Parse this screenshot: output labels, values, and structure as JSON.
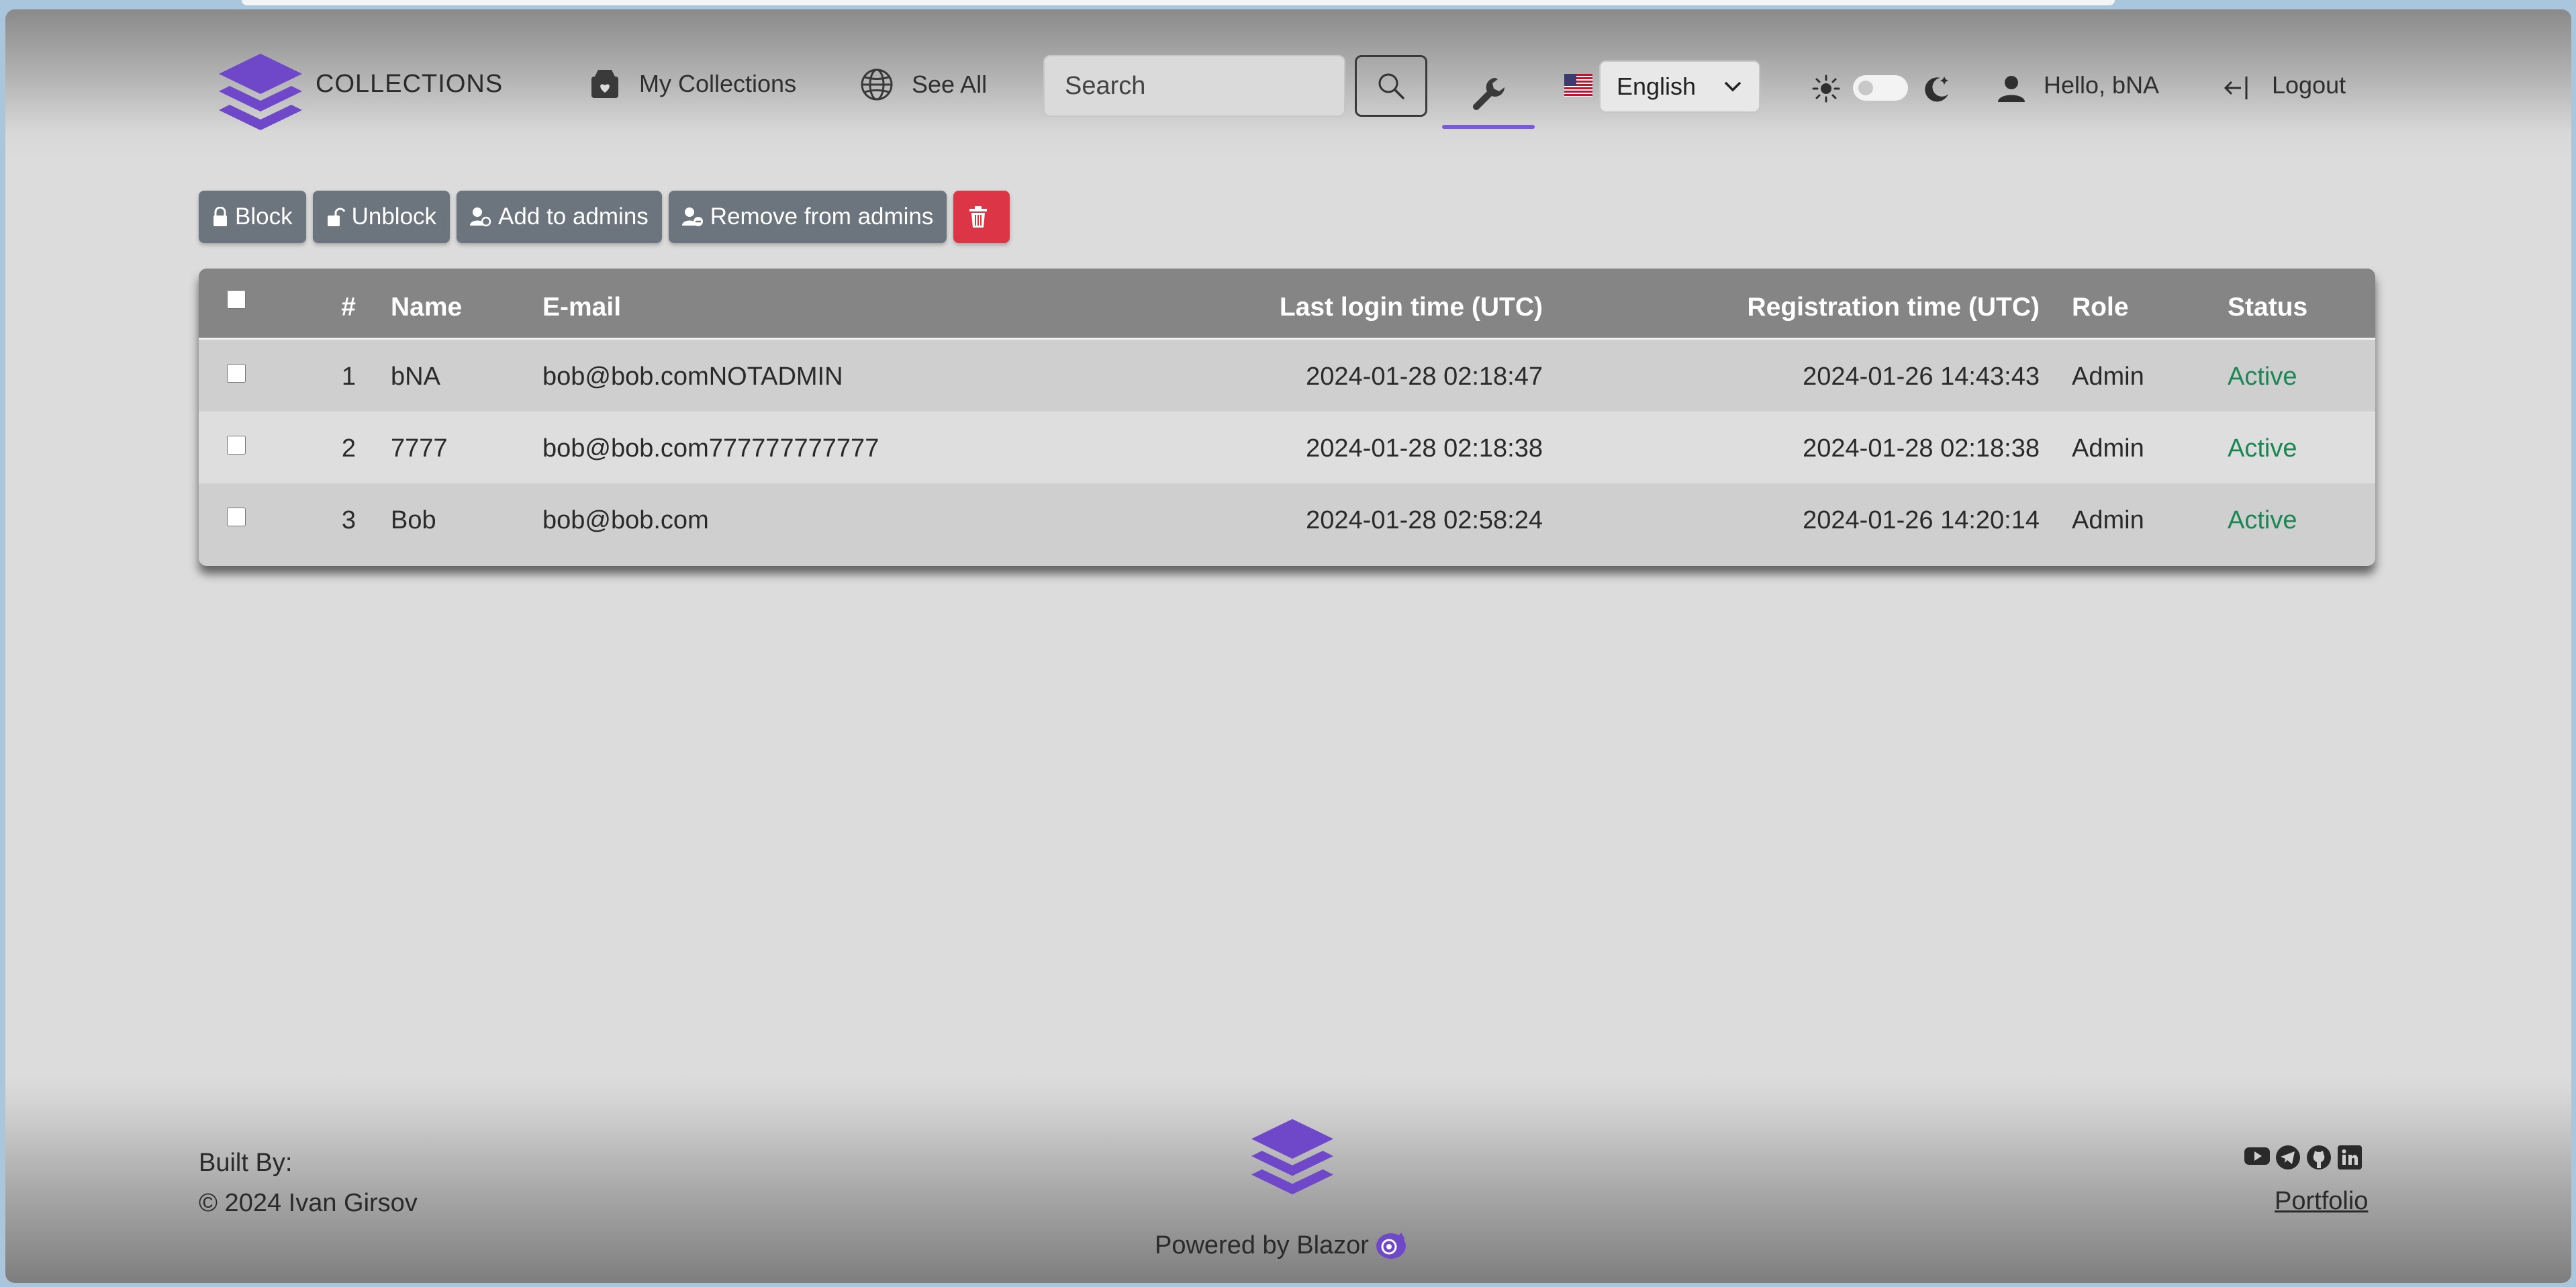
{
  "header": {
    "brand": "COLLECTIONS",
    "nav": [
      {
        "label": "My Collections",
        "icon": "box-heart-icon"
      },
      {
        "label": "See All",
        "icon": "globe-icon"
      }
    ],
    "search": {
      "placeholder": "Search",
      "value": ""
    },
    "language": {
      "selected": "English",
      "flag": "us-flag-icon"
    },
    "theme_toggle": {
      "dark": false
    },
    "user_greeting": "Hello, bNA",
    "logout_label": "Logout",
    "accent_color": "#7b5ad6"
  },
  "toolbar": {
    "block_label": "Block",
    "unblock_label": "Unblock",
    "add_admins_label": "Add to admins",
    "remove_admins_label": "Remove from admins",
    "delete_icon": "trash-icon",
    "delete_color": "#dc3545"
  },
  "table": {
    "columns": [
      "#",
      "Name",
      "E-mail",
      "Last login time (UTC)",
      "Registration time (UTC)",
      "Role",
      "Status"
    ],
    "rows": [
      {
        "num": "1",
        "name": "bNA",
        "email": "bob@bob.comNOTADMIN",
        "last_login": "2024-01-28 02:18:47",
        "registered": "2024-01-26 14:43:43",
        "role": "Admin",
        "status": "Active",
        "checked": false
      },
      {
        "num": "2",
        "name": "7777",
        "email": "bob@bob.com777777777777",
        "last_login": "2024-01-28 02:18:38",
        "registered": "2024-01-28 02:18:38",
        "role": "Admin",
        "status": "Active",
        "checked": false
      },
      {
        "num": "3",
        "name": "Bob",
        "email": "bob@bob.com",
        "last_login": "2024-01-28 02:58:24",
        "registered": "2024-01-26 14:20:14",
        "role": "Admin",
        "status": "Active",
        "checked": false
      }
    ],
    "status_color": "#198754"
  },
  "footer": {
    "built_by": "Built By:",
    "copyright": "© 2024 Ivan Girsov",
    "powered_by": "Powered by Blazor",
    "social": [
      "youtube-icon",
      "telegram-icon",
      "github-icon",
      "linkedin-icon"
    ],
    "portfolio_label": "Portfolio"
  }
}
